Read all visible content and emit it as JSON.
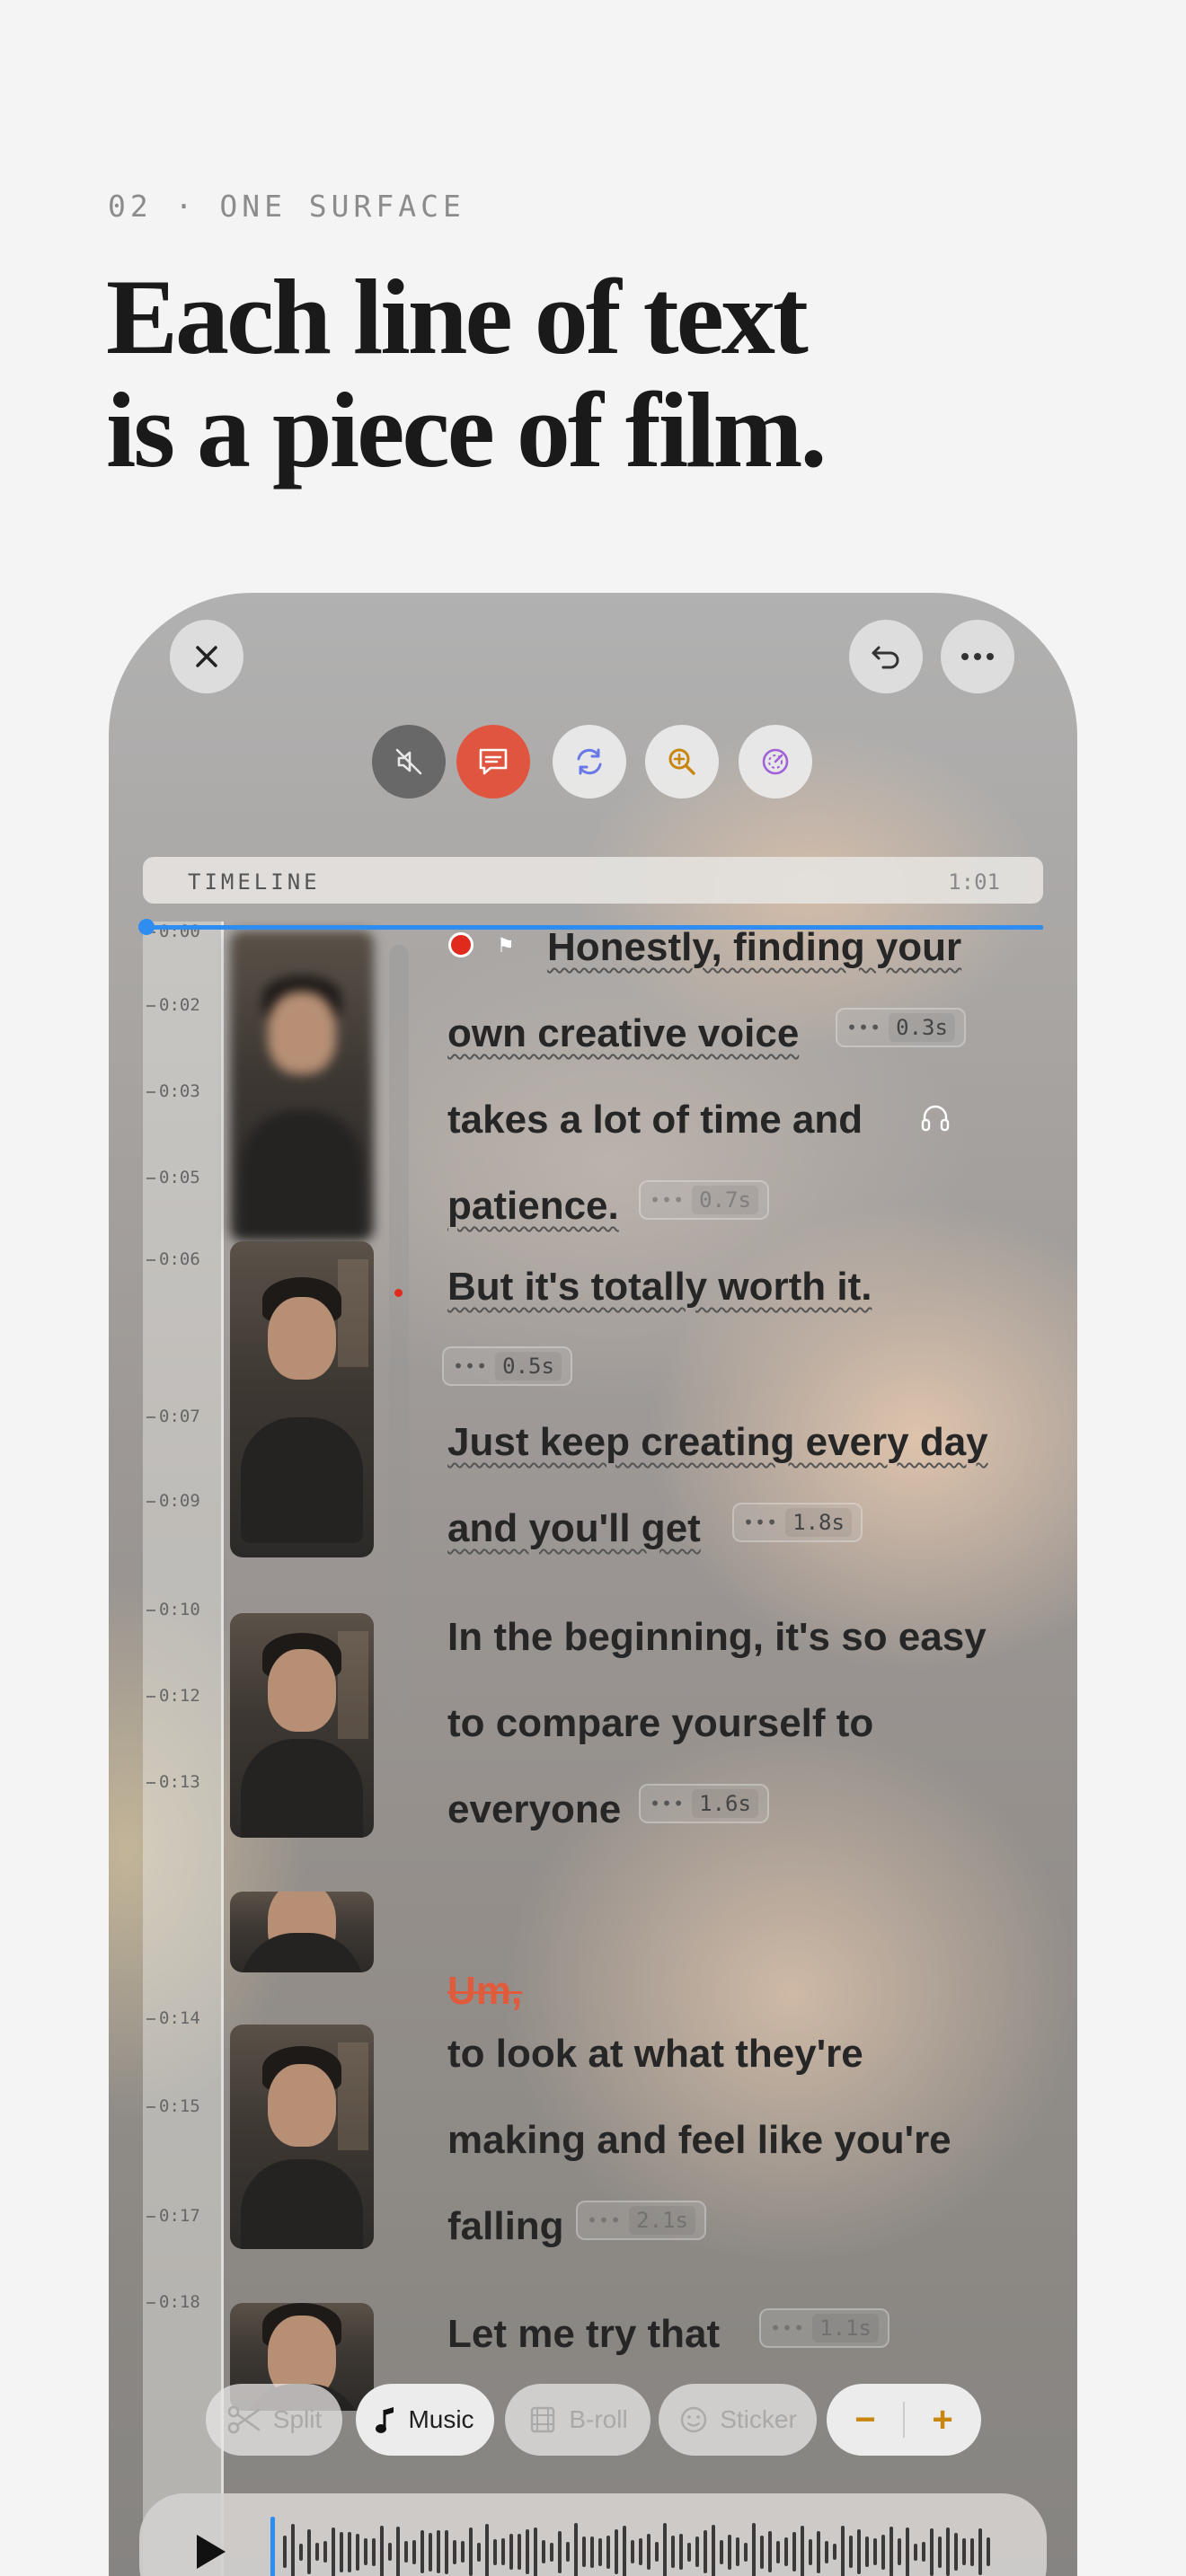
{
  "section": {
    "eyebrow": "02 · ONE SURFACE",
    "headline_line1": "Each line of text",
    "headline_line2": "is a piece of film."
  },
  "top_bar": {
    "close_icon": "close-icon",
    "undo_icon": "undo-icon",
    "more_icon": "more-horizontal-icon"
  },
  "tools": [
    {
      "icon": "mute-icon",
      "color": "#6b6b6b"
    },
    {
      "icon": "captions-icon",
      "color": "#e0553f"
    },
    {
      "icon": "sync-icon",
      "color": "#6a78e8"
    },
    {
      "icon": "zoom-icon",
      "color": "#c8860e"
    },
    {
      "icon": "speed-icon",
      "color": "#a062d8"
    }
  ],
  "timeline": {
    "label": "TIMELINE",
    "duration": "1:01"
  },
  "ruler_ticks": [
    "0:00",
    "0:02",
    "0:03",
    "0:05",
    "0:06",
    "0:07",
    "0:09",
    "0:10",
    "0:12",
    "0:13",
    "0:14",
    "0:15",
    "0:17",
    "0:18"
  ],
  "transcript": {
    "l1": "Honestly, finding your",
    "l2": "own creative voice",
    "l3": "takes a lot of time and",
    "l4": "patience.",
    "l5": "But it's totally worth it.",
    "l6": "Just keep creating every day",
    "l7": "and you'll get",
    "l8": "In the beginning, it's so easy",
    "l9": "to compare yourself to",
    "l10": "everyone",
    "filler": "Um,",
    "l11": "to look at what they're",
    "l12": "making and feel like you're",
    "l13": "falling",
    "l14": "Let me try that"
  },
  "pauses": {
    "p1": "0.3s",
    "p2": "0.7s",
    "p3": "0.5s",
    "p4": "1.8s",
    "p5": "1.6s",
    "p6": "2.1s",
    "p7": "1.1s"
  },
  "bottom_toolbar": {
    "split": "Split",
    "music": "Music",
    "broll": "B-roll",
    "sticker": "Sticker",
    "minus": "−",
    "plus": "+"
  },
  "colors": {
    "accent": "#2f8cf0",
    "record": "#e02a1e",
    "filler": "#e05a3c",
    "zoom": "#c8860e"
  }
}
